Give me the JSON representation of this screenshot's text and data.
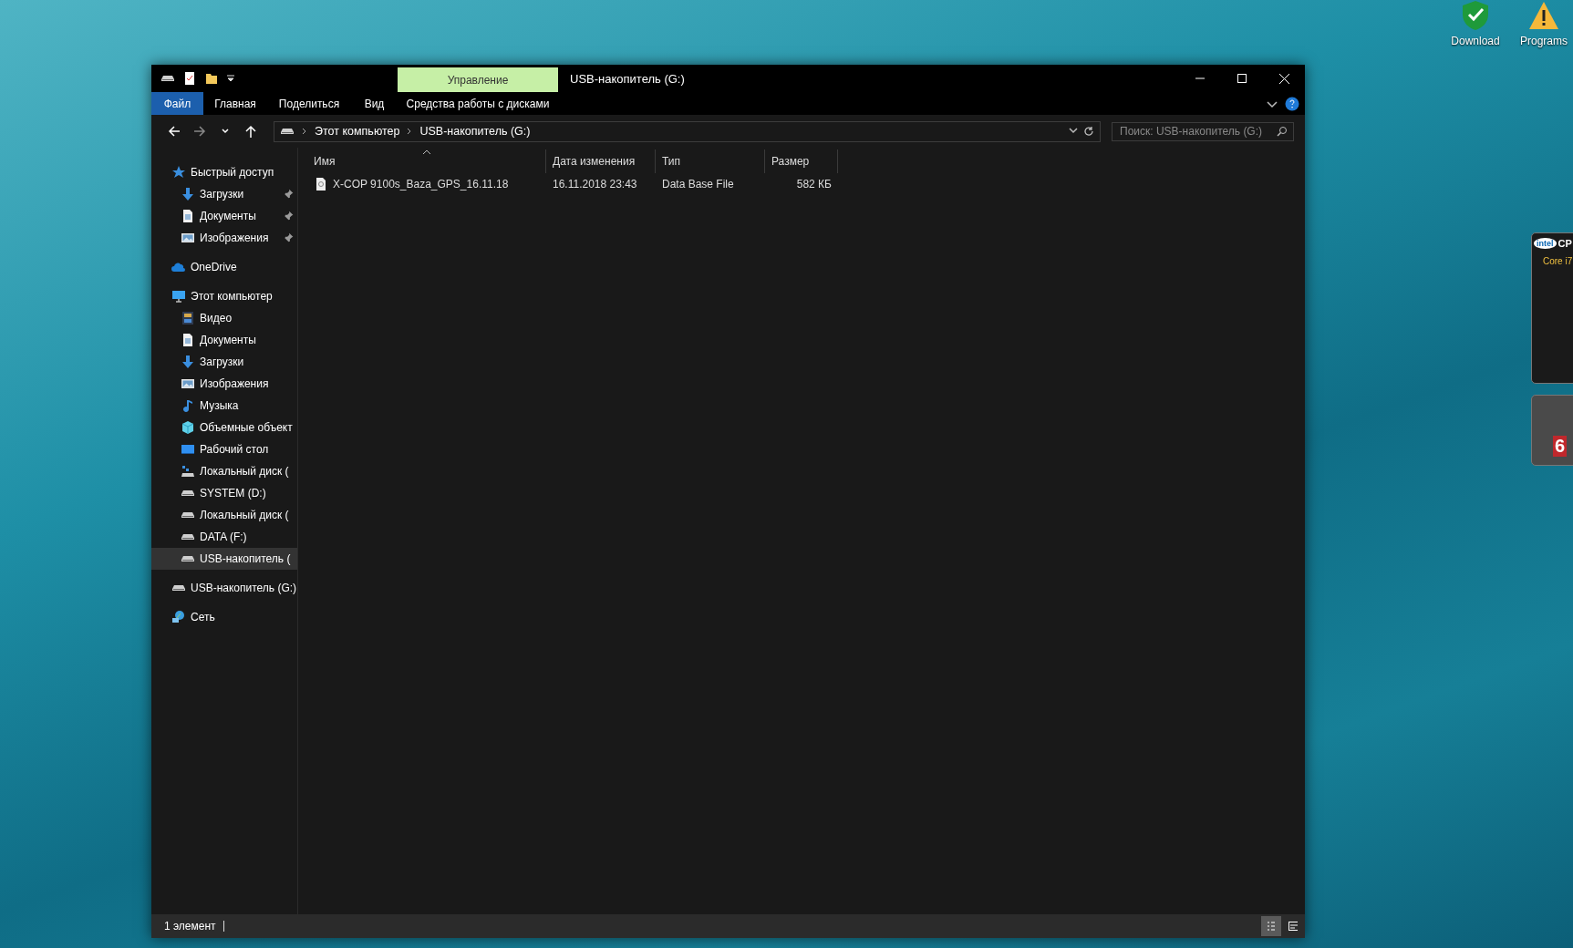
{
  "desktop_icons": [
    {
      "label": "Download",
      "kind": "shield"
    },
    {
      "label": "Programs",
      "kind": "warning"
    }
  ],
  "gadgets": {
    "cpu": {
      "logo": "intel",
      "title": "CP",
      "model": "Core i7"
    },
    "launcher": {
      "badge": "6"
    }
  },
  "window": {
    "title": "USB-накопитель (G:)",
    "context_tab": "Управление"
  },
  "ribbon": {
    "tabs": [
      {
        "label": "Файл",
        "kind": "file"
      },
      {
        "label": "Главная",
        "kind": "plain"
      },
      {
        "label": "Поделиться",
        "kind": "plain"
      },
      {
        "label": "Вид",
        "kind": "plain"
      },
      {
        "label": "Средства работы с дисками",
        "kind": "context"
      }
    ]
  },
  "address": {
    "path": [
      "Этот компьютер",
      "USB-накопитель (G:)"
    ]
  },
  "search": {
    "placeholder": "Поиск: USB-накопитель (G:)"
  },
  "sidebar": {
    "items": [
      {
        "label": "Быстрый доступ",
        "kind": "star",
        "selected": false,
        "children": [
          {
            "label": "Загрузки",
            "kind": "downloads",
            "selected": false,
            "pinned": true
          },
          {
            "label": "Документы",
            "kind": "documents",
            "selected": false,
            "pinned": true
          },
          {
            "label": "Изображения",
            "kind": "pictures",
            "selected": false,
            "pinned": true
          }
        ]
      },
      {
        "label": "OneDrive",
        "kind": "cloud",
        "selected": false
      },
      {
        "label": "Этот компьютер",
        "kind": "computer",
        "selected": false,
        "children": [
          {
            "label": "Видео",
            "kind": "video",
            "selected": false
          },
          {
            "label": "Документы",
            "kind": "documents",
            "selected": false
          },
          {
            "label": "Загрузки",
            "kind": "downloads",
            "selected": false
          },
          {
            "label": "Изображения",
            "kind": "pictures",
            "selected": false
          },
          {
            "label": "Музыка",
            "kind": "music",
            "selected": false
          },
          {
            "label": "Объемные объект",
            "kind": "objects",
            "selected": false
          },
          {
            "label": "Рабочий стол",
            "kind": "desktop",
            "selected": false
          },
          {
            "label": "Локальный диск (",
            "kind": "systemdrive",
            "selected": false
          },
          {
            "label": "SYSTEM (D:)",
            "kind": "drive",
            "selected": false
          },
          {
            "label": "Локальный диск (",
            "kind": "drive",
            "selected": false
          },
          {
            "label": "DATA (F:)",
            "kind": "drive",
            "selected": false
          },
          {
            "label": "USB-накопитель (",
            "kind": "drive",
            "selected": true
          }
        ]
      },
      {
        "label": "USB-накопитель (G:)",
        "kind": "drive",
        "selected": false
      },
      {
        "label": "Сеть",
        "kind": "network",
        "selected": false
      }
    ]
  },
  "table": {
    "columns": [
      {
        "label": "Имя",
        "sorted": true
      },
      {
        "label": "Дата изменения",
        "sorted": false
      },
      {
        "label": "Тип",
        "sorted": false
      },
      {
        "label": "Размер",
        "sorted": false
      }
    ],
    "rows": [
      {
        "name": "X-COP 9100s_Baza_GPS_16.11.18",
        "date": "16.11.2018 23:43",
        "type": "Data Base File",
        "size": "582 КБ",
        "selected": false
      }
    ]
  },
  "status_bar": {
    "text": "1 элемент",
    "views": [
      {
        "kind": "details",
        "selected": true
      },
      {
        "kind": "tiles",
        "selected": false
      }
    ]
  }
}
